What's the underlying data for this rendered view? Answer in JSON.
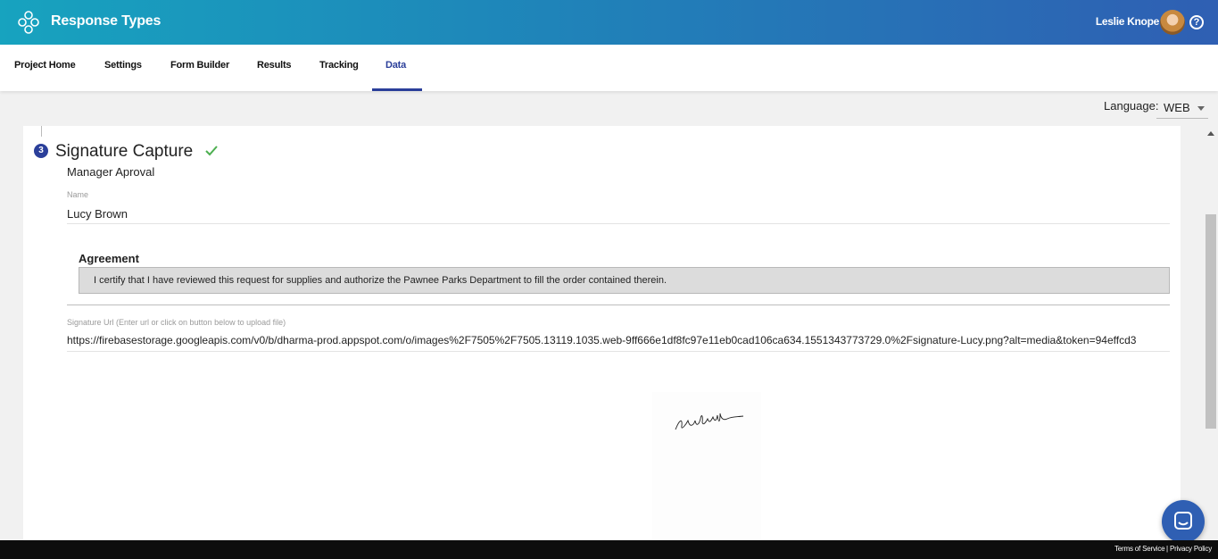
{
  "app": {
    "title": "Response Types",
    "logo_icon": "flower-logo-icon"
  },
  "user": {
    "name": "Leslie Knope",
    "avatar_icon": "avatar",
    "help_icon": "help-icon"
  },
  "tabs": [
    {
      "label": "Project Home"
    },
    {
      "label": "Settings"
    },
    {
      "label": "Form Builder"
    },
    {
      "label": "Results"
    },
    {
      "label": "Tracking"
    },
    {
      "label": "Data",
      "active": true
    }
  ],
  "language": {
    "label": "Language:",
    "value": "WEB"
  },
  "section": {
    "number": "3",
    "title": "Signature Capture",
    "subtitle": "Manager Aproval",
    "status_icon": "check-icon"
  },
  "fields": {
    "name_label": "Name",
    "name_value": "Lucy Brown",
    "agreement_title": "Agreement",
    "agreement_text": "I certify that I have reviewed this request for supplies and authorize the Pawnee Parks Department to fill the order contained therein.",
    "signature_url_label": "Signature Url (Enter url or click on button below to upload file)",
    "signature_url_value": "https://firebasestorage.googleapis.com/v0/b/dharma-prod.appspot.com/o/images%2F7505%2F7505.13119.1035.web-9ff666e1df8fc97e11eb0cad106ca634.1551343773729.0%2Fsignature-Lucy.png?alt=media&token=94effcd3"
  },
  "footer": {
    "terms": "Terms of Service",
    "separator": "|",
    "privacy": "Privacy Policy"
  },
  "colors": {
    "accent": "#2b3f9a",
    "header_start": "#17a3bf",
    "header_end": "#2f5fb3",
    "success": "#4caf50"
  }
}
